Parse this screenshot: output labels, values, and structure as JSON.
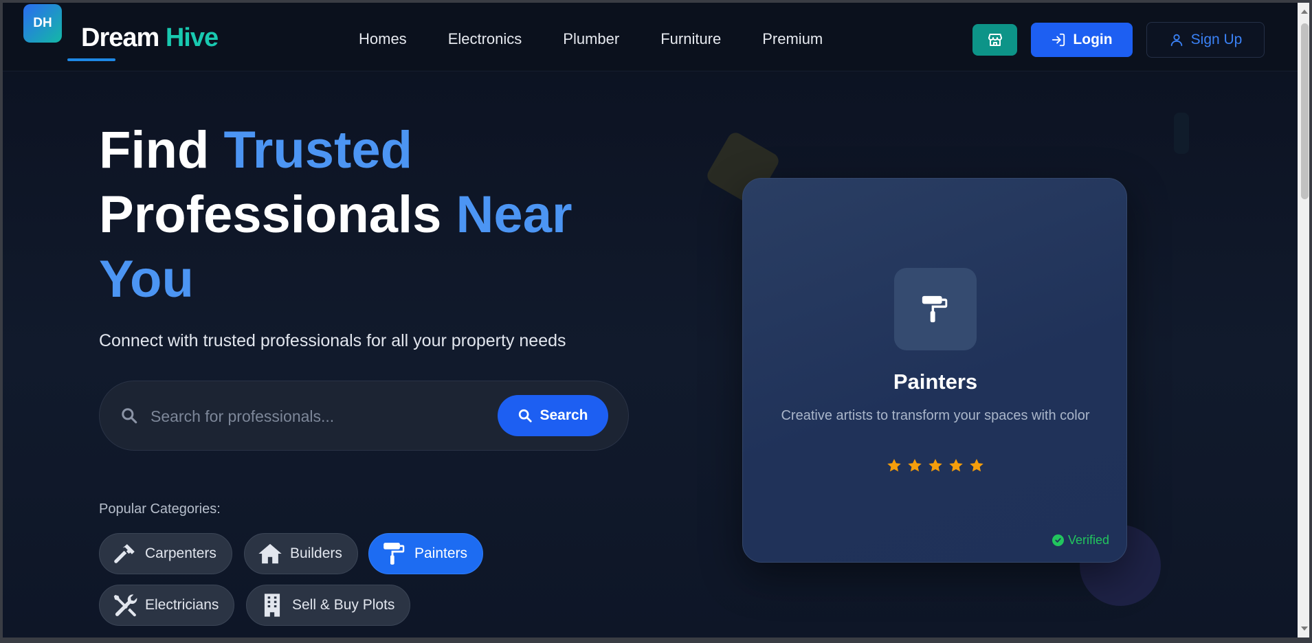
{
  "header": {
    "logo_badge": "DH",
    "brand_primary": "Dream",
    "brand_accent": "Hive",
    "nav": [
      "Homes",
      "Electronics",
      "Plumber",
      "Furniture",
      "Premium"
    ],
    "login_label": "Login",
    "signup_label": "Sign Up",
    "store_icon": "store-icon"
  },
  "hero": {
    "title_line1_plain": "Find",
    "title_line1_accent": "Trusted",
    "title_line2_plain": "Professionals",
    "title_line2_accent": "Near",
    "title_line3_accent": "You",
    "subtitle": "Connect with trusted professionals for all your property needs"
  },
  "search": {
    "placeholder": "Search for professionals...",
    "value": "",
    "button_label": "Search"
  },
  "categories": {
    "label": "Popular Categories:",
    "items": [
      {
        "label": "Carpenters",
        "icon": "hammer-icon",
        "active": false
      },
      {
        "label": "Builders",
        "icon": "house-icon",
        "active": false
      },
      {
        "label": "Painters",
        "icon": "paint-roller-icon",
        "active": true
      },
      {
        "label": "Electricians",
        "icon": "tools-icon",
        "active": false
      },
      {
        "label": "Sell & Buy Plots",
        "icon": "building-icon",
        "active": false
      }
    ]
  },
  "card": {
    "title": "Painters",
    "description": "Creative artists to transform your spaces with color",
    "rating": 5,
    "verified_label": "Verified"
  },
  "colors": {
    "accent_blue": "#1d5ff2",
    "accent_teal": "#19c9b0",
    "star": "#f59e0b",
    "verified": "#22c55e"
  }
}
